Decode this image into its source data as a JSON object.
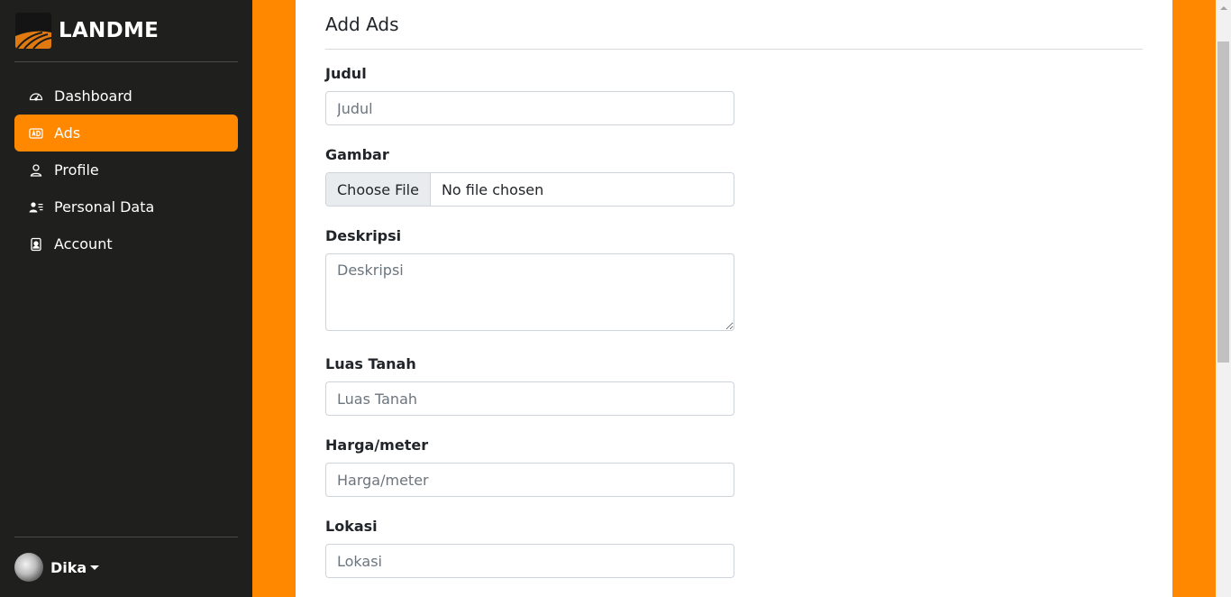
{
  "brand": {
    "name": "LANDME",
    "accent": "#ff8800"
  },
  "sidebar": {
    "items": [
      {
        "label": "Dashboard",
        "icon": "speedometer-icon",
        "active": false
      },
      {
        "label": "Ads",
        "icon": "badge-ad-icon",
        "active": true
      },
      {
        "label": "Profile",
        "icon": "person-icon",
        "active": false
      },
      {
        "label": "Personal Data",
        "icon": "person-lines-icon",
        "active": false
      },
      {
        "label": "Account",
        "icon": "person-badge-icon",
        "active": false
      }
    ],
    "user": {
      "name": "Dika"
    }
  },
  "main": {
    "title": "Add Ads",
    "fields": {
      "judul": {
        "label": "Judul",
        "placeholder": "Judul",
        "value": ""
      },
      "gambar": {
        "label": "Gambar",
        "button": "Choose File",
        "status": "No file chosen"
      },
      "deskripsi": {
        "label": "Deskripsi",
        "placeholder": "Deskripsi",
        "value": ""
      },
      "luas": {
        "label": "Luas Tanah",
        "placeholder": "Luas Tanah",
        "value": ""
      },
      "harga": {
        "label": "Harga/meter",
        "placeholder": "Harga/meter",
        "value": ""
      },
      "lokasi": {
        "label": "Lokasi",
        "placeholder": "Lokasi",
        "value": ""
      }
    }
  }
}
